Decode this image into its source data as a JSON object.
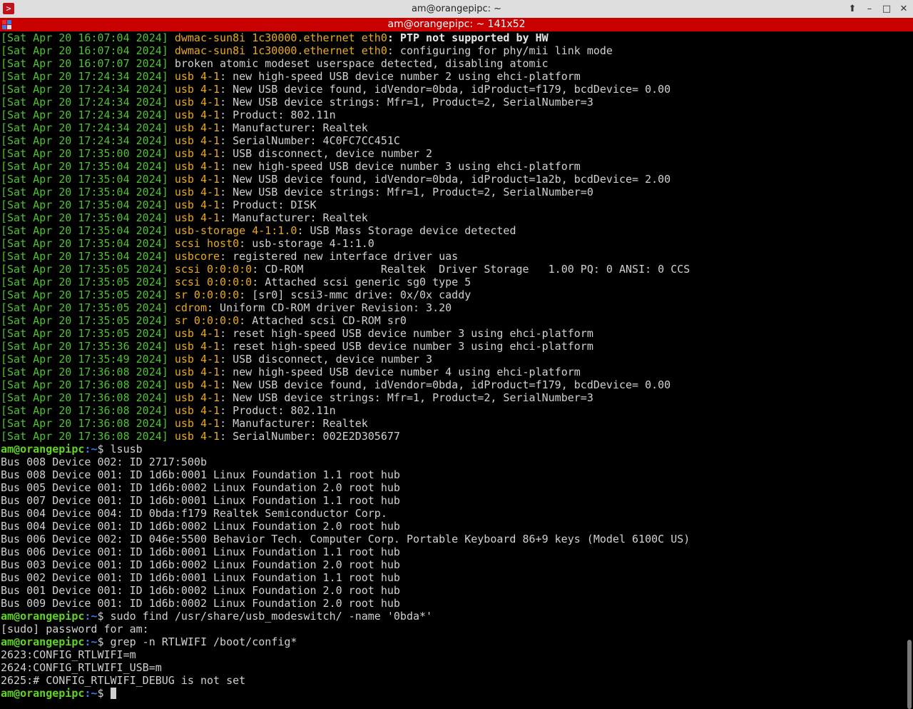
{
  "window": {
    "title": "am@orangepipc: ~",
    "tab_title": "am@orangepipc: ~ 141x52",
    "app_icon": "terminal-icon",
    "controls": {
      "maximize_up": "⬆",
      "minimize": "–",
      "maximize": "□",
      "close": "✕"
    }
  },
  "prompt": {
    "user_host": "am@orangepipc",
    "path": ":~",
    "symbol": "$ "
  },
  "dmesg": [
    {
      "ts": "[Sat Apr 20 16:07:04 2024]",
      "dev": "dwmac-sun8i 1c30000.ethernet eth0",
      "msg": ": PTP not supported by HW",
      "bold": true
    },
    {
      "ts": "[Sat Apr 20 16:07:04 2024]",
      "dev": "dwmac-sun8i 1c30000.ethernet eth0",
      "msg": ": configuring for phy/mii link mode"
    },
    {
      "ts": "[Sat Apr 20 16:07:07 2024]",
      "dev": "",
      "msg": "broken atomic modeset userspace detected, disabling atomic"
    },
    {
      "ts": "[Sat Apr 20 17:24:34 2024]",
      "dev": "usb 4-1",
      "msg": ": new high-speed USB device number 2 using ehci-platform"
    },
    {
      "ts": "[Sat Apr 20 17:24:34 2024]",
      "dev": "usb 4-1",
      "msg": ": New USB device found, idVendor=0bda, idProduct=f179, bcdDevice= 0.00"
    },
    {
      "ts": "[Sat Apr 20 17:24:34 2024]",
      "dev": "usb 4-1",
      "msg": ": New USB device strings: Mfr=1, Product=2, SerialNumber=3"
    },
    {
      "ts": "[Sat Apr 20 17:24:34 2024]",
      "dev": "usb 4-1",
      "msg": ": Product: 802.11n"
    },
    {
      "ts": "[Sat Apr 20 17:24:34 2024]",
      "dev": "usb 4-1",
      "msg": ": Manufacturer: Realtek"
    },
    {
      "ts": "[Sat Apr 20 17:24:34 2024]",
      "dev": "usb 4-1",
      "msg": ": SerialNumber: 4C0FC7CC451C"
    },
    {
      "ts": "[Sat Apr 20 17:35:00 2024]",
      "dev": "usb 4-1",
      "msg": ": USB disconnect, device number 2"
    },
    {
      "ts": "[Sat Apr 20 17:35:04 2024]",
      "dev": "usb 4-1",
      "msg": ": new high-speed USB device number 3 using ehci-platform"
    },
    {
      "ts": "[Sat Apr 20 17:35:04 2024]",
      "dev": "usb 4-1",
      "msg": ": New USB device found, idVendor=0bda, idProduct=1a2b, bcdDevice= 2.00"
    },
    {
      "ts": "[Sat Apr 20 17:35:04 2024]",
      "dev": "usb 4-1",
      "msg": ": New USB device strings: Mfr=1, Product=2, SerialNumber=0"
    },
    {
      "ts": "[Sat Apr 20 17:35:04 2024]",
      "dev": "usb 4-1",
      "msg": ": Product: DISK"
    },
    {
      "ts": "[Sat Apr 20 17:35:04 2024]",
      "dev": "usb 4-1",
      "msg": ": Manufacturer: Realtek"
    },
    {
      "ts": "[Sat Apr 20 17:35:04 2024]",
      "dev": "usb-storage 4-1:1.0",
      "msg": ": USB Mass Storage device detected"
    },
    {
      "ts": "[Sat Apr 20 17:35:04 2024]",
      "dev": "scsi host0",
      "msg": ": usb-storage 4-1:1.0"
    },
    {
      "ts": "[Sat Apr 20 17:35:04 2024]",
      "dev": "usbcore",
      "msg": ": registered new interface driver uas"
    },
    {
      "ts": "[Sat Apr 20 17:35:05 2024]",
      "dev": "scsi 0:0:0:0",
      "msg": ": CD-ROM            Realtek  Driver Storage   1.00 PQ: 0 ANSI: 0 CCS"
    },
    {
      "ts": "[Sat Apr 20 17:35:05 2024]",
      "dev": "scsi 0:0:0:0",
      "msg": ": Attached scsi generic sg0 type 5"
    },
    {
      "ts": "[Sat Apr 20 17:35:05 2024]",
      "dev": "sr 0:0:0:0",
      "msg": ": [sr0] scsi3-mmc drive: 0x/0x caddy"
    },
    {
      "ts": "[Sat Apr 20 17:35:05 2024]",
      "dev": "cdrom",
      "msg": ": Uniform CD-ROM driver Revision: 3.20"
    },
    {
      "ts": "[Sat Apr 20 17:35:05 2024]",
      "dev": "sr 0:0:0:0",
      "msg": ": Attached scsi CD-ROM sr0"
    },
    {
      "ts": "[Sat Apr 20 17:35:05 2024]",
      "dev": "usb 4-1",
      "msg": ": reset high-speed USB device number 3 using ehci-platform"
    },
    {
      "ts": "[Sat Apr 20 17:35:36 2024]",
      "dev": "usb 4-1",
      "msg": ": reset high-speed USB device number 3 using ehci-platform"
    },
    {
      "ts": "[Sat Apr 20 17:35:49 2024]",
      "dev": "usb 4-1",
      "msg": ": USB disconnect, device number 3"
    },
    {
      "ts": "[Sat Apr 20 17:36:08 2024]",
      "dev": "usb 4-1",
      "msg": ": new high-speed USB device number 4 using ehci-platform"
    },
    {
      "ts": "[Sat Apr 20 17:36:08 2024]",
      "dev": "usb 4-1",
      "msg": ": New USB device found, idVendor=0bda, idProduct=f179, bcdDevice= 0.00"
    },
    {
      "ts": "[Sat Apr 20 17:36:08 2024]",
      "dev": "usb 4-1",
      "msg": ": New USB device strings: Mfr=1, Product=2, SerialNumber=3"
    },
    {
      "ts": "[Sat Apr 20 17:36:08 2024]",
      "dev": "usb 4-1",
      "msg": ": Product: 802.11n"
    },
    {
      "ts": "[Sat Apr 20 17:36:08 2024]",
      "dev": "usb 4-1",
      "msg": ": Manufacturer: Realtek"
    },
    {
      "ts": "[Sat Apr 20 17:36:08 2024]",
      "dev": "usb 4-1",
      "msg": ": SerialNumber: 002E2D305677"
    }
  ],
  "cmd_lsusb": {
    "command": "lsusb",
    "output": [
      "Bus 008 Device 002: ID 2717:500b",
      "Bus 008 Device 001: ID 1d6b:0001 Linux Foundation 1.1 root hub",
      "Bus 005 Device 001: ID 1d6b:0002 Linux Foundation 2.0 root hub",
      "Bus 007 Device 001: ID 1d6b:0001 Linux Foundation 1.1 root hub",
      "Bus 004 Device 004: ID 0bda:f179 Realtek Semiconductor Corp.",
      "Bus 004 Device 001: ID 1d6b:0002 Linux Foundation 2.0 root hub",
      "Bus 006 Device 002: ID 046e:5500 Behavior Tech. Computer Corp. Portable Keyboard 86+9 keys (Model 6100C US)",
      "Bus 006 Device 001: ID 1d6b:0001 Linux Foundation 1.1 root hub",
      "Bus 003 Device 001: ID 1d6b:0002 Linux Foundation 2.0 root hub",
      "Bus 002 Device 001: ID 1d6b:0001 Linux Foundation 1.1 root hub",
      "Bus 001 Device 001: ID 1d6b:0002 Linux Foundation 2.0 root hub",
      "Bus 009 Device 001: ID 1d6b:0002 Linux Foundation 2.0 root hub"
    ]
  },
  "cmd_find": {
    "command": "sudo find /usr/share/usb_modeswitch/ -name '0bda*'",
    "output": [
      "[sudo] password for am:"
    ]
  },
  "cmd_grep": {
    "command": "grep -n RTLWIFI /boot/config*",
    "output": [
      "2623:CONFIG_RTLWIFI=m",
      "2624:CONFIG_RTLWIFI_USB=m",
      "2625:# CONFIG_RTLWIFI_DEBUG is not set"
    ]
  },
  "colors": {
    "timestamp": "#4ec232",
    "device": "#e8a91c",
    "prompt_user": "#62d427",
    "prompt_path": "#3a7be8",
    "tab_bar": "#c80000"
  }
}
